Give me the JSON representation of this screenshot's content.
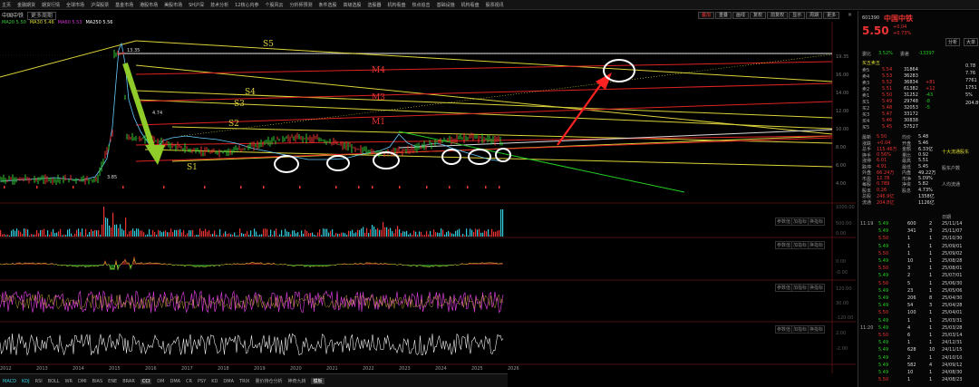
{
  "menu": [
    "主页",
    "金融期货",
    "期货行情",
    "全球市场",
    "沪深股票",
    "基金市场",
    "港股市场",
    "美股市场",
    "SH沪深",
    "技术分析",
    "12核心内参",
    "个股风云",
    "分析师预测",
    "条件选股",
    "高级选股",
    "选股器",
    "机构看盘",
    "热点追击",
    "基础设施",
    "机构看盘",
    "股票视讯"
  ],
  "chart_title": "中国中铁",
  "title_buttons": [
    "更多周期"
  ],
  "ma_legend": [
    {
      "text": "MA20 5.50",
      "color": "#3c3"
    },
    {
      "text": "MA30 5.46",
      "color": "#dd3"
    },
    {
      "text": "MA60 5.53",
      "color": "#c3c"
    },
    {
      "text": "MA250 5.56",
      "color": "#fff"
    }
  ],
  "toolbar": [
    "叠加",
    "重叠",
    "画线",
    "复权",
    "前复权",
    "显示",
    "周期",
    "更多"
  ],
  "top_right": {
    "prev": "",
    "next": "",
    "close": "×"
  },
  "line_labels": {
    "S1": "S1",
    "S2": "S2",
    "S3": "S3",
    "S4": "S4",
    "S5": "S5",
    "M1": "M1",
    "M2": "M2",
    "M3": "M3",
    "M4": "M4"
  },
  "price_ticks": [
    "19.35",
    "16.00",
    "14.00",
    "12.00",
    "10.00",
    "8.00",
    "6.00",
    "4.00"
  ],
  "price_text": {
    "peak": "13.35",
    "left_low": "3.85",
    "mid": "4.74"
  },
  "years": [
    "2012",
    "2013",
    "2014",
    "2015",
    "2016",
    "2017",
    "2018",
    "2019",
    "2020",
    "2021",
    "2022",
    "2023",
    "2024",
    "2025",
    "2026"
  ],
  "pane_tools": [
    "参数值",
    "加指标",
    "换指标"
  ],
  "pane_values": {
    "vol_top": "1000.00",
    "vol_mid": "500.00",
    "vol_low": "0.00",
    "macd_top": "0.00",
    "macd_low": "-0.00",
    "p3_top": "120.00",
    "p3_mid": "30.00",
    "p3_low": "-120.00",
    "p4_top": "2.00",
    "p4_low": "-2.00"
  },
  "bottom_tabs": [
    {
      "label": "MACD",
      "style": "cyan"
    },
    {
      "label": "KDJ",
      "style": "cyan"
    },
    {
      "label": "RSI",
      "style": ""
    },
    {
      "label": "BOLL",
      "style": ""
    },
    {
      "label": "WR",
      "style": ""
    },
    {
      "label": "DMI",
      "style": ""
    },
    {
      "label": "BIAS",
      "style": ""
    },
    {
      "label": "ENE",
      "style": ""
    },
    {
      "label": "BRAR",
      "style": ""
    },
    {
      "label": "CCI",
      "style": "act"
    },
    {
      "label": "DM",
      "style": ""
    },
    {
      "label": "DMA",
      "style": ""
    },
    {
      "label": "CR",
      "style": ""
    },
    {
      "label": "PSY",
      "style": ""
    },
    {
      "label": "KD",
      "style": ""
    },
    {
      "label": "DMA",
      "style": ""
    },
    {
      "label": "TRIX",
      "style": ""
    },
    {
      "label": "量价持仓分析",
      "style": ""
    },
    {
      "label": "神奇九转",
      "style": ""
    },
    {
      "label": "模板",
      "style": "act"
    }
  ],
  "stock": {
    "code": "601390",
    "name": "中国中铁",
    "price": "5.50",
    "change": "+0.04",
    "pct": "+0.73%",
    "buttons": [
      "分析",
      "大单"
    ],
    "header_labels": {
      "committee": "委比",
      "diff": "委差"
    },
    "committee": "3.52%",
    "diff": "-13397",
    "order_book_title": "买五卖五",
    "asks": [
      {
        "l": "卖5",
        "p": "5.54",
        "v": "31864",
        "d": ""
      },
      {
        "l": "卖4",
        "p": "5.53",
        "v": "36283",
        "d": ""
      },
      {
        "l": "卖3",
        "p": "5.52",
        "v": "36834",
        "d": "+81"
      },
      {
        "l": "卖2",
        "p": "5.51",
        "v": "61382",
        "d": "+12"
      },
      {
        "l": "卖1",
        "p": "5.50",
        "v": "31252",
        "d": "-43"
      }
    ],
    "bids": [
      {
        "l": "买1",
        "p": "5.49",
        "v": "29748",
        "d": "-8"
      },
      {
        "l": "买2",
        "p": "5.48",
        "v": "32053",
        "d": "-5"
      },
      {
        "l": "买3",
        "p": "5.47",
        "v": "33172",
        "d": ""
      },
      {
        "l": "买4",
        "p": "5.46",
        "v": "30838",
        "d": ""
      },
      {
        "l": "买5",
        "p": "5.45",
        "v": "57527",
        "d": ""
      }
    ],
    "stats": [
      {
        "k": "最新",
        "v": "5.50",
        "k2": "均价",
        "v2": "5.48"
      },
      {
        "k": "涨跌",
        "v": "+0.04",
        "k2": "开盘",
        "v2": "5.46"
      },
      {
        "k": "总手",
        "v": "115.46万",
        "k2": "金额",
        "v2": "6.33亿"
      },
      {
        "k": "换手",
        "v": "0.56%",
        "k2": "量比",
        "v2": "0.92"
      },
      {
        "k": "涨停",
        "v": "6.01",
        "k2": "最高",
        "v2": "5.51"
      },
      {
        "k": "跌停",
        "v": "4.91",
        "k2": "最低",
        "v2": "5.45"
      },
      {
        "k": "外盘",
        "v": "66.24万",
        "k2": "内盘",
        "v2": "49.22万"
      },
      {
        "k": "市盈",
        "v": "12.78",
        "k2": "市净",
        "v2": "5.09%"
      },
      {
        "k": "每股",
        "v": "0.789",
        "k2": "净资",
        "v2": "5.82"
      },
      {
        "k": "股本",
        "v": "0.26",
        "k2": "股息",
        "v2": "4.73%"
      },
      {
        "k": "总股",
        "v": "246.9亿",
        "k2": "",
        "v2": "1358亿"
      },
      {
        "k": "流通",
        "v": "204.8亿",
        "k2": "",
        "v2": "1126亿"
      }
    ],
    "ticks": [
      {
        "t": "11:19",
        "p": "5.49",
        "v": "600",
        "n": "2"
      },
      {
        "t": "",
        "p": "5.49",
        "v": "341",
        "n": "3"
      },
      {
        "t": "",
        "p": "5.50",
        "v": "1",
        "n": "1"
      },
      {
        "t": "",
        "p": "5.49",
        "v": "1",
        "n": "1"
      },
      {
        "t": "",
        "p": "5.50",
        "v": "1",
        "n": "1"
      },
      {
        "t": "",
        "p": "5.49",
        "v": "10",
        "n": "1"
      },
      {
        "t": "",
        "p": "5.50",
        "v": "3",
        "n": "1"
      },
      {
        "t": "",
        "p": "5.49",
        "v": "2",
        "n": "1"
      },
      {
        "t": "",
        "p": "5.50",
        "v": "5",
        "n": "1"
      },
      {
        "t": "",
        "p": "5.49",
        "v": "23",
        "n": "1"
      },
      {
        "t": "",
        "p": "5.49",
        "v": "206",
        "n": "8"
      },
      {
        "t": "",
        "p": "5.49",
        "v": "54",
        "n": "3"
      },
      {
        "t": "",
        "p": "5.50",
        "v": "100",
        "n": "1"
      },
      {
        "t": "",
        "p": "5.49",
        "v": "1",
        "n": "1"
      },
      {
        "t": "11:20",
        "p": "5.49",
        "v": "4",
        "n": "1"
      },
      {
        "t": "",
        "p": "5.50",
        "v": "6",
        "n": "1"
      },
      {
        "t": "",
        "p": "5.49",
        "v": "1",
        "n": "1"
      },
      {
        "t": "",
        "p": "5.49",
        "v": "628",
        "n": "10"
      },
      {
        "t": "",
        "p": "5.49",
        "v": "2",
        "n": "1"
      },
      {
        "t": "",
        "p": "5.49",
        "v": "582",
        "n": "4"
      },
      {
        "t": "",
        "p": "5.49",
        "v": "10",
        "n": "1"
      },
      {
        "t": "",
        "p": "5.50",
        "v": "1",
        "n": "1"
      }
    ],
    "right_col": {
      "labels": [
        "换手",
        "",
        "",
        "流通",
        "",
        "",
        ""
      ],
      "vals": [
        "0.78",
        "7.76",
        "7761",
        "1751",
        "5%",
        "204.8亿"
      ]
    },
    "right_lower": {
      "title": "十大流通股东",
      "items": [
        "股东户数",
        "",
        "人均流通",
        "",
        "",
        "",
        "日期"
      ],
      "dates": [
        "25/11/14",
        "25/11/07",
        "25/10/30",
        "25/09/01",
        "25/09/02",
        "25/08/28",
        "25/08/01",
        "25/07/01",
        "25/06/30",
        "25/05/06",
        "25/04/30",
        "25/04/28",
        "25/04/01",
        "25/03/31",
        "25/03/28",
        "25/03/14",
        "24/12/31",
        "24/11/15",
        "24/10/10",
        "24/09/12",
        "24/08/30",
        "24/08/23"
      ]
    }
  }
}
